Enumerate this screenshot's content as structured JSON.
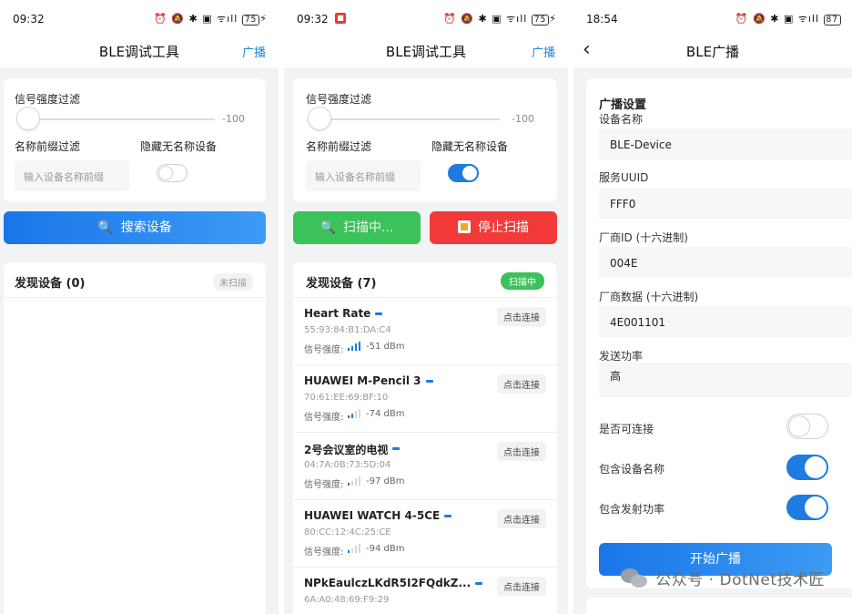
{
  "common": {
    "app_title": "BLE调试工具",
    "broadcast_link": "广播",
    "status_icons": "⏰ 🔕 ✱ ▣ ᯤıll"
  },
  "phone1": {
    "time": "09:32",
    "battery": "75",
    "rssi_filter_label": "信号强度过滤",
    "rssi_value": "-100",
    "prefix_filter_label": "名称前缀过滤",
    "hide_unnamed_label": "隐藏无名称设备",
    "prefix_placeholder": "输入设备名称前缀",
    "hide_unnamed_on": false,
    "scan_button": "搜索设备",
    "devices_title": "发现设备 (0)",
    "scan_state": "未扫描"
  },
  "phone2": {
    "time": "09:32",
    "battery": "75",
    "rssi_filter_label": "信号强度过滤",
    "rssi_value": "-100",
    "prefix_filter_label": "名称前缀过滤",
    "hide_unnamed_label": "隐藏无名称设备",
    "prefix_placeholder": "输入设备名称前缀",
    "hide_unnamed_on": true,
    "scanning_button": "扫描中...",
    "stop_button": "停止扫描",
    "devices_title": "发现设备 (7)",
    "scan_state": "扫描中",
    "rssi_prefix": "信号强度:",
    "connect_label": "点击连接",
    "devices": [
      {
        "name": "Heart Rate",
        "mac": "55:93:84:B1:DA:C4",
        "rssi": "-51 dBm",
        "bars": 4
      },
      {
        "name": "HUAWEI M-Pencil 3",
        "mac": "70:61:EE:69:BF:10",
        "rssi": "-74 dBm",
        "bars": 2
      },
      {
        "name": "2号会议室的电视",
        "mac": "04:7A:0B:73:5D:04",
        "rssi": "-97 dBm",
        "bars": 1
      },
      {
        "name": "HUAWEI WATCH 4-5CE",
        "mac": "80:CC:12:4C:25:CE",
        "rssi": "-94 dBm",
        "bars": 1
      },
      {
        "name": "NPkEaulczLKdR5I2FQdkZ...",
        "mac": "6A:A0:48:69:F9:29",
        "rssi": "",
        "bars": 0
      }
    ]
  },
  "phone3": {
    "time": "18:54",
    "battery": "87",
    "title": "BLE广播",
    "section_title": "广播设置",
    "device_name_label": "设备名称",
    "device_name_value": "BLE-Device",
    "service_uuid_label": "服务UUID",
    "service_uuid_value": "FFF0",
    "vendor_id_label": "厂商ID (十六进制)",
    "vendor_id_value": "004E",
    "vendor_data_label": "厂商数据 (十六进制)",
    "vendor_data_value": "4E001101",
    "tx_power_label": "发送功率",
    "tx_power_value": "高",
    "connectable_label": "是否可连接",
    "connectable_on": false,
    "include_name_label": "包含设备名称",
    "include_name_on": true,
    "include_power_label": "包含发射功率",
    "include_power_on": true,
    "start_button": "开始广播"
  },
  "watermark": "公众号 · DotNet技术匠"
}
